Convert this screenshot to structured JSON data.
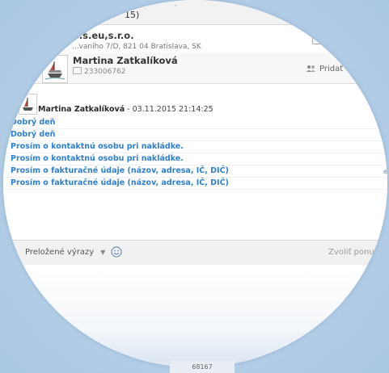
{
  "top": {
    "partial_label": "15)",
    "partial_label_2": "-"
  },
  "company": {
    "name": "...s.eu,s.r.o.",
    "address": "...vaniho 7/D, 821 04 Bratislava, SK"
  },
  "contact": {
    "name": "Martina Zatkalíková",
    "phone": "233006762",
    "add_to_label": "Pridať do"
  },
  "message": {
    "author": "Martina Zatkalíková",
    "timestamp": " - 03.11.2015 21:14:25",
    "lines": [
      "Dobrý deň",
      "Dobrý deň",
      "Prosím o kontaktnú osobu pri nakládke.",
      "Prosím o kontaktnú osobu pri nakládke.",
      "Prosím o fakturačné údaje (názov, adresa, IČ, DIČ)",
      "Prosím o fakturačné údaje (názov, adresa, IČ, DIČ)"
    ]
  },
  "toolbar": {
    "translated_phrases": "Preložené výrazy",
    "choose_menu": "Zvoliť ponuku"
  },
  "bottom": {
    "peek_text": "68167"
  },
  "side": {
    "peek_text": "e"
  }
}
